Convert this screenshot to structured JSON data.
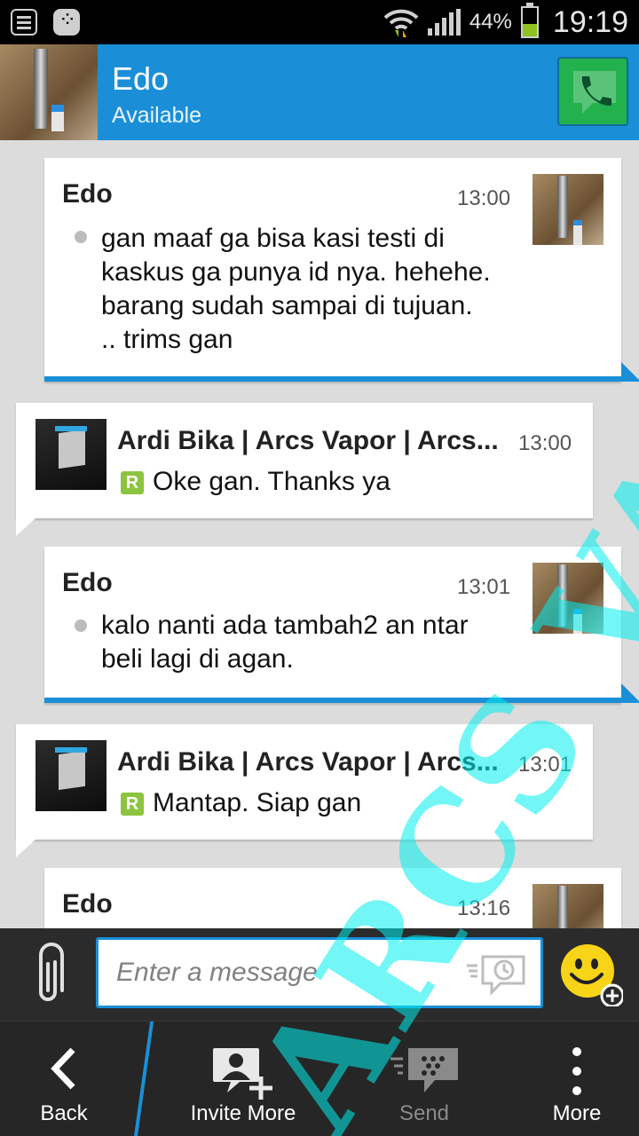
{
  "status_bar": {
    "battery_percent": "44%",
    "battery_level": 0.44,
    "time": "19:19"
  },
  "header": {
    "contact_name": "Edo",
    "contact_status": "Available",
    "call_icon": "phone-icon",
    "accent_color": "#1a8fd8"
  },
  "messages": [
    {
      "direction": "in",
      "sender": "Edo",
      "time": "13:00",
      "text": [
        "gan maaf ga bisa kasi testi di",
        "kaskus ga punya id nya. hehehe.",
        "barang sudah sampai di tujuan.",
        ".. trims gan"
      ]
    },
    {
      "direction": "out",
      "sender": "Ardi Bika | Arcs Vapor | Arcs...",
      "time": "13:00",
      "read_badge": "R",
      "text": [
        "Oke gan. Thanks ya"
      ]
    },
    {
      "direction": "in",
      "sender": "Edo",
      "time": "13:01",
      "text": [
        "kalo nanti ada tambah2 an ntar",
        "beli lagi di agan."
      ]
    },
    {
      "direction": "out",
      "sender": "Ardi Bika | Arcs Vapor | Arcs...",
      "time": "13:01",
      "read_badge": "R",
      "text": [
        "Mantap. Siap gan"
      ]
    },
    {
      "direction": "in",
      "sender": "Edo",
      "time": "13:16",
      "text": []
    }
  ],
  "watermark": "ARCS VAPOR",
  "compose": {
    "placeholder": "Enter a message"
  },
  "actions": {
    "back": "Back",
    "invite_more": "Invite More",
    "send": "Send",
    "more": "More"
  }
}
